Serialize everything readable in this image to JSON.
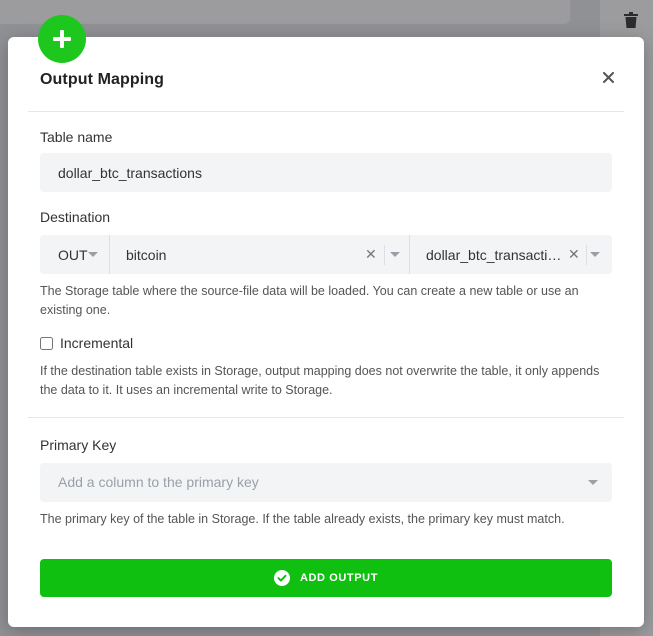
{
  "modal": {
    "title": "Output Mapping",
    "table_name": {
      "label": "Table name",
      "value": "dollar_btc_transactions"
    },
    "destination": {
      "label": "Destination",
      "stage": "OUT",
      "bucket": "bitcoin",
      "table": "dollar_btc_transactio…",
      "help": "The Storage table where the source-file data will be loaded. You can create a new table or use an existing one."
    },
    "incremental": {
      "label": "Incremental",
      "checked": false,
      "help": "If the destination table exists in Storage, output mapping does not overwrite the table, it only appends the data to it. It uses an incremental write to Storage."
    },
    "primary_key": {
      "label": "Primary Key",
      "placeholder": "Add a column to the primary key",
      "help": "The primary key of the table in Storage. If the table already exists, the primary key must match."
    },
    "submit_label": "ADD OUTPUT"
  },
  "colors": {
    "accent_green": "#10c010",
    "badge_green": "#1ec71e"
  },
  "icons": {
    "badge": "plus-icon",
    "close": "close-icon",
    "submit": "check-circle-icon",
    "background": "trash-icon"
  }
}
